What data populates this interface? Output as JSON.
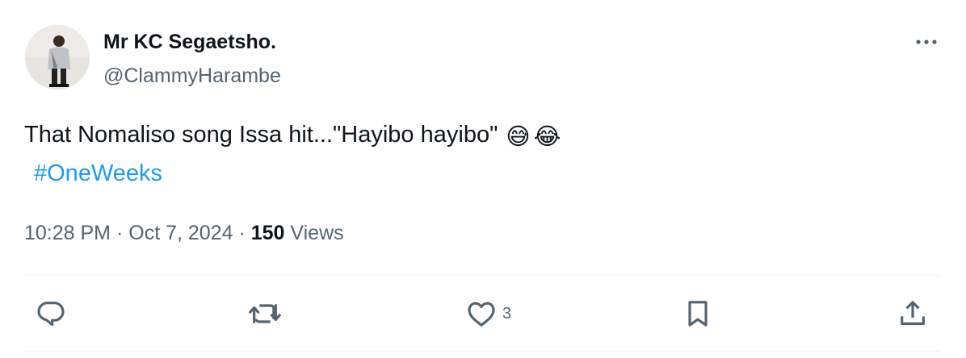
{
  "author": {
    "display_name": "Mr KC Segaetsho.",
    "handle": "@ClammyHarambe"
  },
  "tweet": {
    "text": "That Nomaliso song Issa hit...\"Hayibo hayibo\"",
    "emoji_1": "😅",
    "emoji_2": "😂",
    "hashtag": "#OneWeeks"
  },
  "meta": {
    "time": "10:28 PM",
    "date": "Oct 7, 2024",
    "views_count": "150",
    "views_label": "Views",
    "separator": "·"
  },
  "actions": {
    "like_count": "3"
  },
  "colors": {
    "link": "#1d9bf0",
    "secondary_text": "#536471",
    "primary_text": "#0f1419"
  }
}
